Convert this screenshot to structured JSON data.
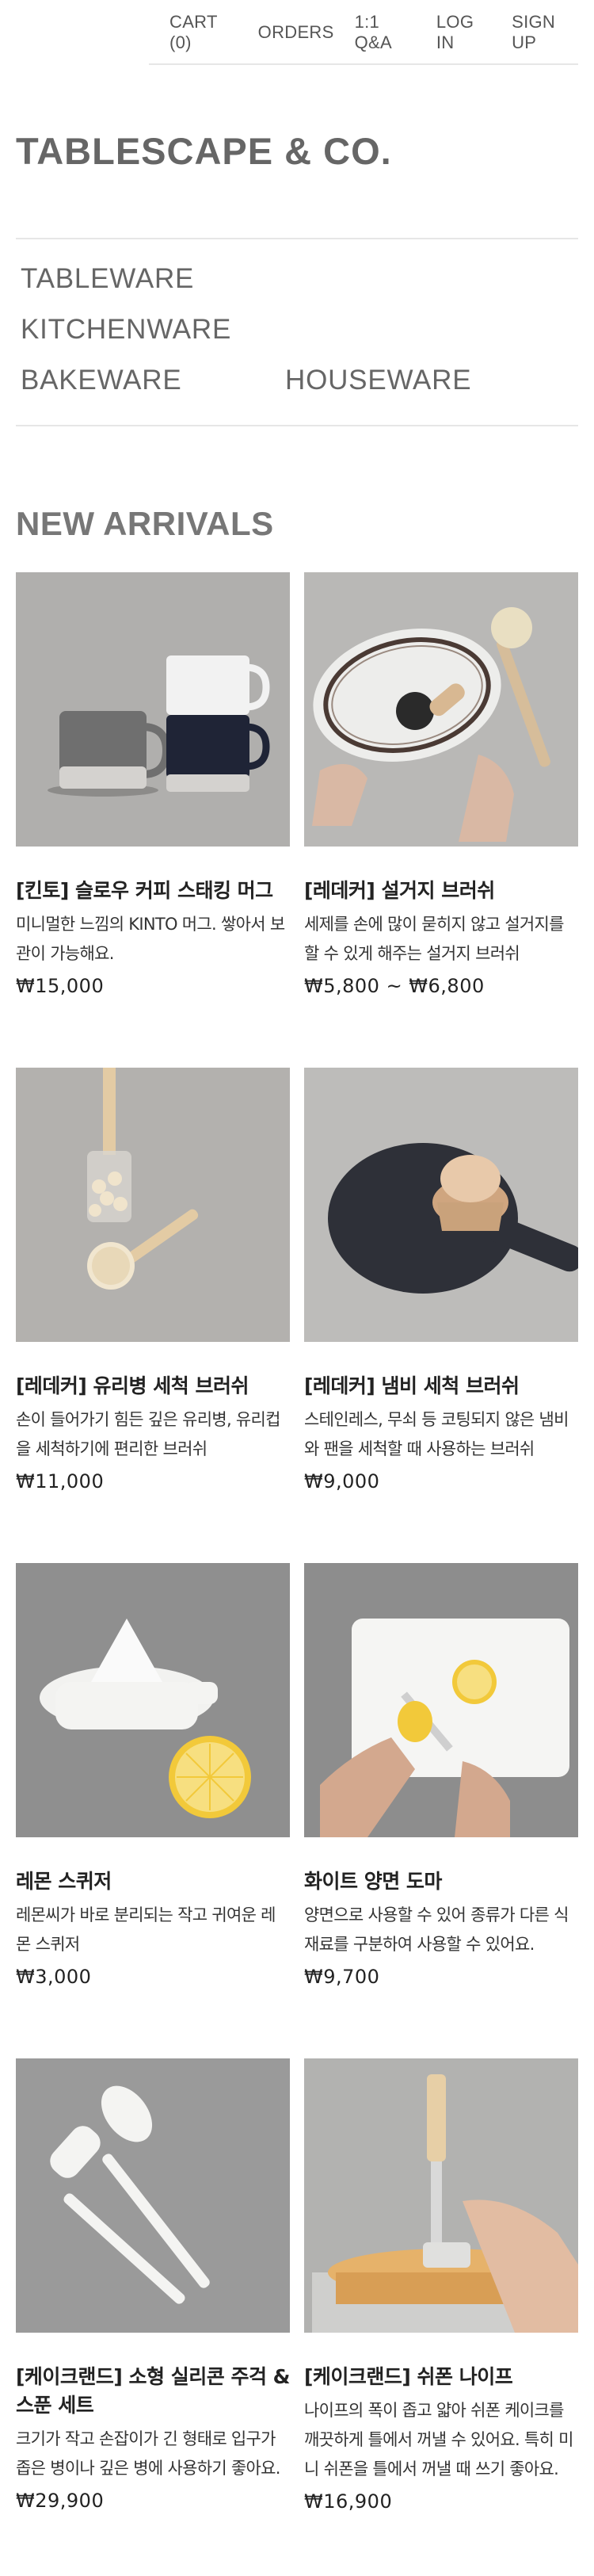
{
  "topnav": {
    "cart": "CART (0)",
    "orders": "ORDERS",
    "qa": "1:1 Q&A",
    "login": "LOG IN",
    "signup": "SIGN UP"
  },
  "brand": "TABLESCAPE & CO.",
  "categories": {
    "tableware": "TABLEWARE",
    "kitchenware": "KITCHENWARE",
    "bakeware": "BAKEWARE",
    "houseware": "HOUSEWARE"
  },
  "section_title": "NEW ARRIVALS",
  "products": [
    {
      "title": "[킨토] 슬로우 커피 스태킹 머그",
      "desc": "미니멀한 느낌의 KINTO 머그. 쌓아서 보관이 가능해요.",
      "price": "₩15,000",
      "image": "stacking-mugs-image"
    },
    {
      "title": "[레데커] 설거지 브러쉬",
      "desc": "세제를 손에 많이 묻히지 않고 설거지를 할 수 있게 해주는 설거지 브러쉬",
      "price": "₩5,800 ~ ₩6,800",
      "image": "dish-brush-image"
    },
    {
      "title": "[레데커] 유리병 세척 브러쉬",
      "desc": "손이 들어가기 힘든 깊은 유리병, 유리컵을 세척하기에 편리한 브러쉬",
      "price": "₩11,000",
      "image": "bottle-brush-image"
    },
    {
      "title": "[레데커] 냄비 세척 브러쉬",
      "desc": "스테인레스, 무쇠 등 코팅되지 않은 냄비와 팬을 세척할 때 사용하는 브러쉬",
      "price": "₩9,000",
      "image": "pot-brush-image"
    },
    {
      "title": "레몬 스퀴저",
      "desc": "레몬씨가 바로 분리되는 작고 귀여운 레몬 스퀴저",
      "price": "₩3,000",
      "image": "lemon-squeezer-image"
    },
    {
      "title": "화이트 양면 도마",
      "desc": "양면으로 사용할 수 있어 종류가 다른 식재료를 구분하여 사용할 수 있어요.",
      "price": "₩9,700",
      "image": "cutting-board-image"
    },
    {
      "title": "[케이크랜드] 소형 실리콘 주걱 & 스푼 세트",
      "desc": "크기가 작고 손잡이가 긴 형태로 입구가 좁은 병이나 깊은 병에 사용하기 좋아요.",
      "price": "₩29,900",
      "image": "silicone-spatula-image"
    },
    {
      "title": "[케이크랜드] 쉬폰 나이프",
      "desc": "나이프의 폭이 좁고 얇아 쉬폰 케이크를 깨끗하게 틀에서 꺼낼 수 있어요. 특히 미니 쉬폰을 틀에서 꺼낼 때 쓰기 좋아요.",
      "price": "₩16,900",
      "image": "chiffon-knife-image"
    }
  ]
}
